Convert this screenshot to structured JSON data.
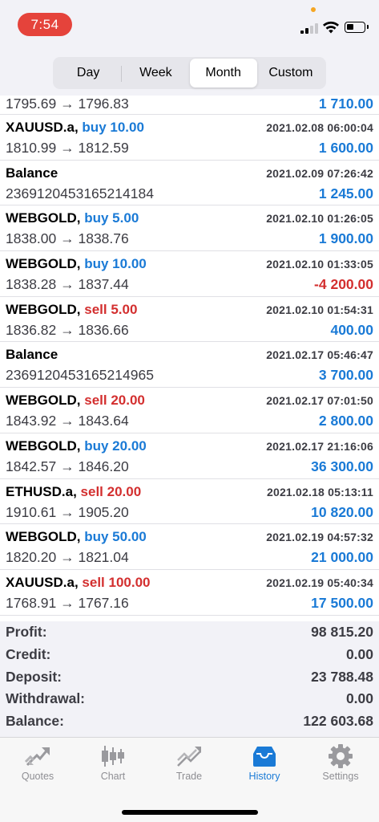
{
  "status_bar": {
    "time": "7:54",
    "time_pill_color": "#e5433b"
  },
  "period_tabs": [
    {
      "label": "Day",
      "active": false
    },
    {
      "label": "Week",
      "active": false
    },
    {
      "label": "Month",
      "active": true
    },
    {
      "label": "Custom",
      "active": false
    }
  ],
  "colors": {
    "buy": "#1a7ad6",
    "sell": "#d32f2f",
    "positive": "#1a7ad6",
    "negative": "#d32f2f"
  },
  "partial_row": {
    "prices": "1795.69 → 1796.83",
    "value": "1 710.00"
  },
  "rows": [
    {
      "symbol": "XAUUSD.a,",
      "direction": "buy 10.00",
      "type": "buy",
      "datetime": "2021.02.08 06:00:04",
      "prices": "1810.99 → 1812.59",
      "value": "1 600.00",
      "negative": false
    },
    {
      "symbol": "Balance",
      "direction": "",
      "type": "balance",
      "datetime": "2021.02.09 07:26:42",
      "prices": "2369120453165214184",
      "value": "1 245.00",
      "negative": false
    },
    {
      "symbol": "WEBGOLD,",
      "direction": "buy 5.00",
      "type": "buy",
      "datetime": "2021.02.10 01:26:05",
      "prices": "1838.00 → 1838.76",
      "value": "1 900.00",
      "negative": false
    },
    {
      "symbol": "WEBGOLD,",
      "direction": "buy 10.00",
      "type": "buy",
      "datetime": "2021.02.10 01:33:05",
      "prices": "1838.28 → 1837.44",
      "value": "-4 200.00",
      "negative": true
    },
    {
      "symbol": "WEBGOLD,",
      "direction": "sell 5.00",
      "type": "sell",
      "datetime": "2021.02.10 01:54:31",
      "prices": "1836.82 → 1836.66",
      "value": "400.00",
      "negative": false
    },
    {
      "symbol": "Balance",
      "direction": "",
      "type": "balance",
      "datetime": "2021.02.17 05:46:47",
      "prices": "2369120453165214965",
      "value": "3 700.00",
      "negative": false
    },
    {
      "symbol": "WEBGOLD,",
      "direction": "sell 20.00",
      "type": "sell",
      "datetime": "2021.02.17 07:01:50",
      "prices": "1843.92 → 1843.64",
      "value": "2 800.00",
      "negative": false
    },
    {
      "symbol": "WEBGOLD,",
      "direction": "buy 20.00",
      "type": "buy",
      "datetime": "2021.02.17 21:16:06",
      "prices": "1842.57 → 1846.20",
      "value": "36 300.00",
      "negative": false
    },
    {
      "symbol": "ETHUSD.a,",
      "direction": "sell 20.00",
      "type": "sell",
      "datetime": "2021.02.18 05:13:11",
      "prices": "1910.61 → 1905.20",
      "value": "10 820.00",
      "negative": false
    },
    {
      "symbol": "WEBGOLD,",
      "direction": "buy 50.00",
      "type": "buy",
      "datetime": "2021.02.19 04:57:32",
      "prices": "1820.20 → 1821.04",
      "value": "21 000.00",
      "negative": false
    },
    {
      "symbol": "XAUUSD.a,",
      "direction": "sell 100.00",
      "type": "sell",
      "datetime": "2021.02.19 05:40:34",
      "prices": "1768.91 → 1767.16",
      "value": "17 500.00",
      "negative": false
    }
  ],
  "summary": [
    {
      "label": "Profit:",
      "value": "98 815.20"
    },
    {
      "label": "Credit:",
      "value": "0.00"
    },
    {
      "label": "Deposit:",
      "value": "23 788.48"
    },
    {
      "label": "Withdrawal:",
      "value": "0.00"
    },
    {
      "label": "Balance:",
      "value": "122 603.68"
    }
  ],
  "tabbar": [
    {
      "label": "Quotes",
      "icon": "quotes-icon",
      "active": false
    },
    {
      "label": "Chart",
      "icon": "candlestick-icon",
      "active": false
    },
    {
      "label": "Trade",
      "icon": "trade-icon",
      "active": false
    },
    {
      "label": "History",
      "icon": "inbox-tray-icon",
      "active": true
    },
    {
      "label": "Settings",
      "icon": "gear-icon",
      "active": false
    }
  ]
}
